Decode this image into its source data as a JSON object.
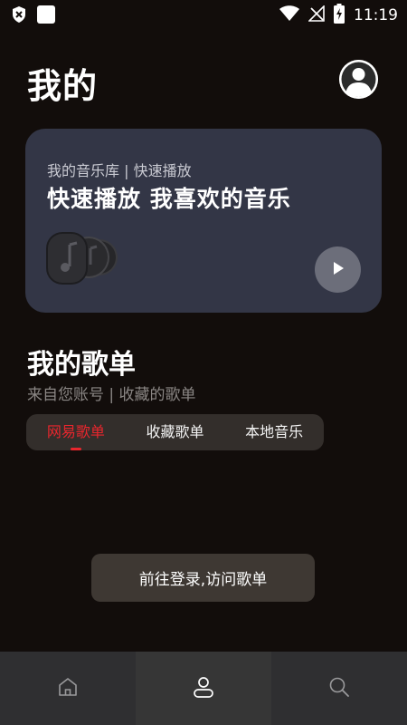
{
  "status_bar": {
    "time": "11:19",
    "icons": [
      "shield-x-icon",
      "square-notification-icon",
      "wifi-icon",
      "no-signal-icon",
      "battery-charging-icon"
    ]
  },
  "header": {
    "title": "我的",
    "avatar_icon": "user-avatar-icon"
  },
  "quick_card": {
    "subtitle": "我的音乐库 | 快速播放",
    "title": "快速播放 我喜欢的音乐",
    "play_icon": "play-icon"
  },
  "playlists": {
    "title": "我的歌单",
    "subtitle": "来自您账号 | 收藏的歌单",
    "tabs": [
      {
        "label": "网易歌单",
        "active": true
      },
      {
        "label": "收藏歌单",
        "active": false
      },
      {
        "label": "本地音乐",
        "active": false
      }
    ],
    "login_button": "前往登录,访问歌单"
  },
  "bottom_nav": [
    {
      "icon": "home-icon",
      "active": false
    },
    {
      "icon": "user-icon",
      "active": true
    },
    {
      "icon": "search-icon",
      "active": false
    }
  ],
  "colors": {
    "background": "#120d0b",
    "card": "#333646",
    "accent": "#e8262d"
  }
}
